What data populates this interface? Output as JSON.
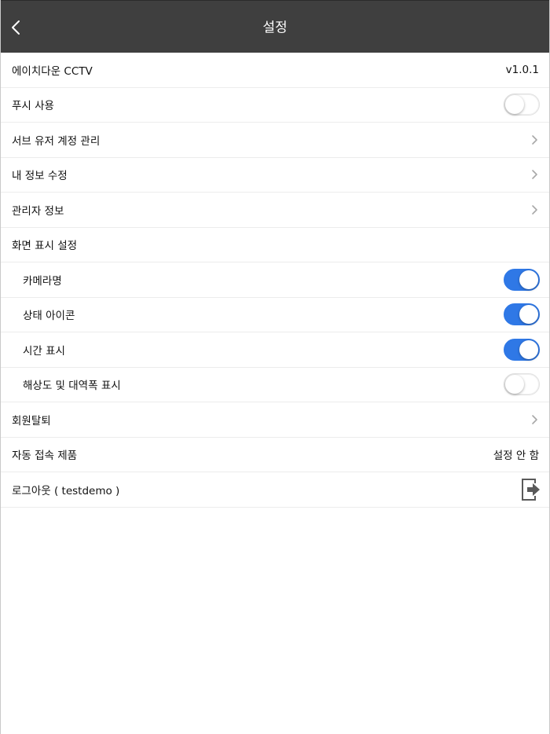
{
  "header": {
    "title": "설정",
    "back_icon": "chevron-left-icon"
  },
  "colors": {
    "header_bg": "#3f3f3f",
    "toggle_on": "#2f78e6",
    "divider": "#ececec"
  },
  "rows": [
    {
      "label": "에이치다운 CCTV",
      "value": "v1.0.1"
    },
    {
      "label": "푸시 사용",
      "toggle": "off"
    },
    {
      "label": "서브 유저 계정 관리",
      "icon": "chevron-right-icon"
    },
    {
      "label": "내 정보 수정",
      "icon": "chevron-right-icon"
    },
    {
      "label": "관리자 정보",
      "icon": "chevron-right-icon"
    },
    {
      "label": "화면 표시 설정"
    },
    {
      "label": "카메라명",
      "toggle": "on"
    },
    {
      "label": "상태 아이콘",
      "toggle": "on"
    },
    {
      "label": "시간 표시",
      "toggle": "on"
    },
    {
      "label": "해상도 및 대역폭 표시",
      "toggle": "off"
    },
    {
      "label": "회원탈퇴",
      "icon": "chevron-right-icon"
    },
    {
      "label": "자동 접속 제품",
      "value": "설정 안 함"
    },
    {
      "label": "로그아웃 ( testdemo )",
      "icon": "logout-icon"
    }
  ]
}
